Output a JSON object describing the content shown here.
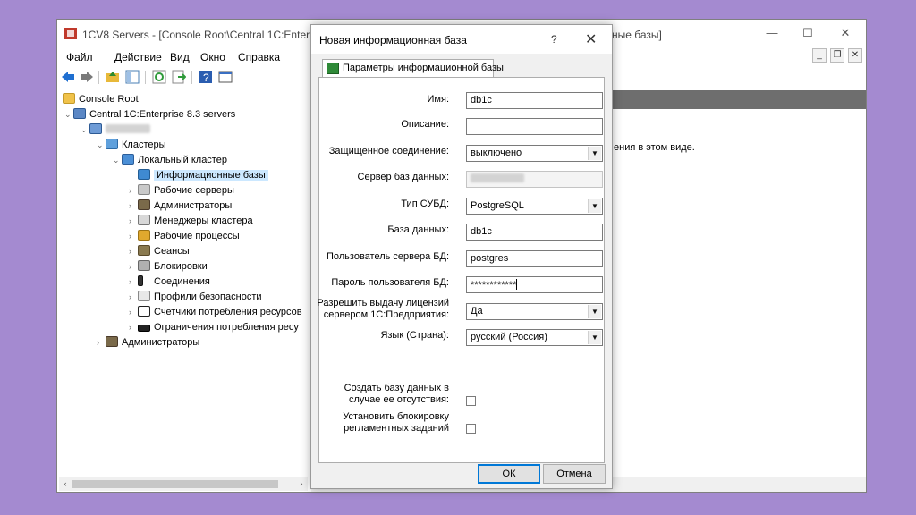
{
  "window": {
    "title": "1CV8 Servers - [Console Root\\Central 1C:Enterprise 8",
    "title_tail": "ные базы]"
  },
  "menu": [
    "Файл",
    "Действие",
    "Вид",
    "Окно",
    "Справка"
  ],
  "tree": {
    "root": "Console Root",
    "server": "Central 1C:Enterprise 8.3 servers",
    "clusters": "Кластеры",
    "local_cluster": "Локальный кластер",
    "items": [
      "Информационные базы",
      "Рабочие серверы",
      "Администраторы",
      "Менеджеры кластера",
      "Рабочие процессы",
      "Сеансы",
      "Блокировки",
      "Соединения",
      "Профили безопасности",
      "Счетчики потребления ресурсов",
      "Ограничения потребления ресу"
    ],
    "admins": "Администраторы"
  },
  "right_pane": {
    "text": "ения в этом виде."
  },
  "dialog": {
    "title": "Новая информационная база",
    "help": "?",
    "tab": "Параметры информационной базы",
    "labels": {
      "name": "Имя:",
      "description": "Описание:",
      "secure": "Защищенное соединение:",
      "db_server": "Сервер баз данных:",
      "dbms": "Тип СУБД:",
      "database": "База данных:",
      "db_user": "Пользователь сервера БД:",
      "db_password": "Пароль пользователя БД:",
      "license_1": "Разрешить выдачу лицензий",
      "license_2": "сервером 1С:Предприятия:",
      "language": "Язык (Страна):",
      "create_1": "Создать базу данных в",
      "create_2": "случае ее отсутствия:",
      "lock_1": "Установить блокировку",
      "lock_2": "регламентных заданий"
    },
    "values": {
      "name": "db1c",
      "description": "",
      "secure": "выключено",
      "dbms": "PostgreSQL",
      "database": "db1c",
      "db_user": "postgres",
      "db_password": "************",
      "license": "Да",
      "language": "русский (Россия)",
      "create_db": false,
      "lock_jobs": false
    },
    "ok": "ОК",
    "cancel": "Отмена"
  },
  "colors": {
    "background": "#a48ad0",
    "accent": "#0078d7",
    "selection": "#cce8ff"
  }
}
